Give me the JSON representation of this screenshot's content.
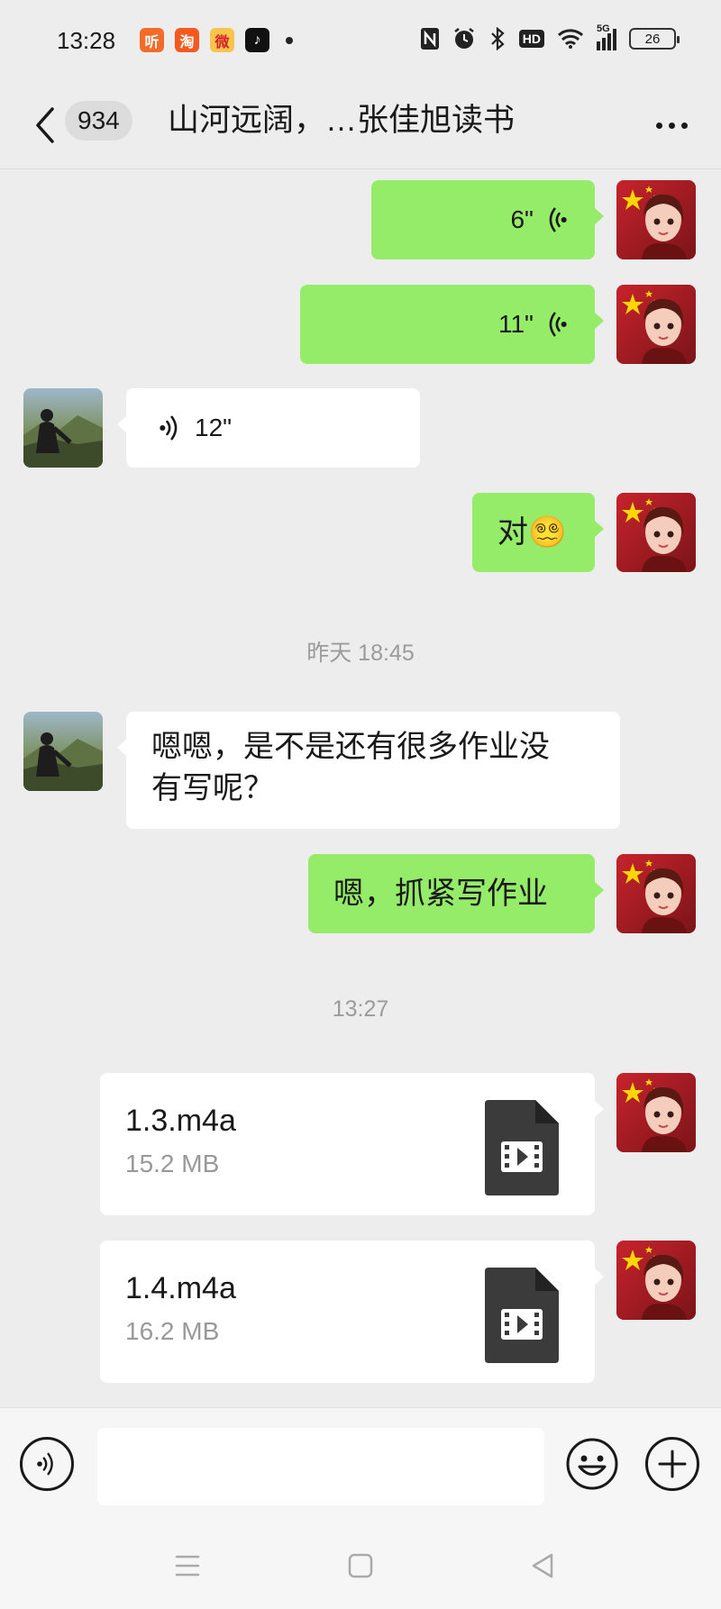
{
  "status_bar": {
    "time": "13:28",
    "app_icons": [
      {
        "name": "ting-app-icon",
        "glyph": "听",
        "color": "#f26b2a"
      },
      {
        "name": "taobao-app-icon",
        "glyph": "淘",
        "color": "#f45a1e"
      },
      {
        "name": "weibo-app-icon",
        "glyph": "微",
        "color": "#f7c44c"
      },
      {
        "name": "douyin-app-icon",
        "glyph": "♪",
        "color": "#111111"
      }
    ],
    "network": "5G",
    "hd_label": "HD",
    "battery": "26"
  },
  "header": {
    "back_icon": "chevron-left-icon",
    "unread_count": "934",
    "title": "山河远阔，…张佳旭读书",
    "more_icon": "more-dots-icon"
  },
  "messages": [
    {
      "side": "me",
      "kind": "voice",
      "duration": "6\""
    },
    {
      "side": "me",
      "kind": "voice",
      "duration": "11\""
    },
    {
      "side": "other",
      "kind": "voice",
      "duration": "12\""
    },
    {
      "side": "me",
      "kind": "text",
      "text": "对😵‍💫"
    },
    {
      "kind": "timestamp",
      "text": "昨天 18:45"
    },
    {
      "side": "other",
      "kind": "text",
      "line1": "嗯嗯，是不是还有很多作业没",
      "line2": "有写呢？"
    },
    {
      "side": "me",
      "kind": "text",
      "text": "嗯，抓紧写作业"
    },
    {
      "kind": "timestamp",
      "text": "13:27"
    },
    {
      "side": "me",
      "kind": "file",
      "name": "1.3.m4a",
      "size": "15.2 MB"
    },
    {
      "side": "me",
      "kind": "file",
      "name": "1.4.m4a",
      "size": "16.2 MB"
    }
  ],
  "input_bar": {
    "voice_icon": "voice-input-icon",
    "text_value": "",
    "emoji_icon": "emoji-icon",
    "plus_icon": "plus-icon"
  },
  "system_nav": {
    "menu_icon": "menu-icon",
    "home_icon": "home-icon",
    "back_icon": "back-triangle-icon"
  },
  "colors": {
    "my_bubble": "#95ec69",
    "other_bubble": "#ffffff",
    "background": "#ededed"
  }
}
